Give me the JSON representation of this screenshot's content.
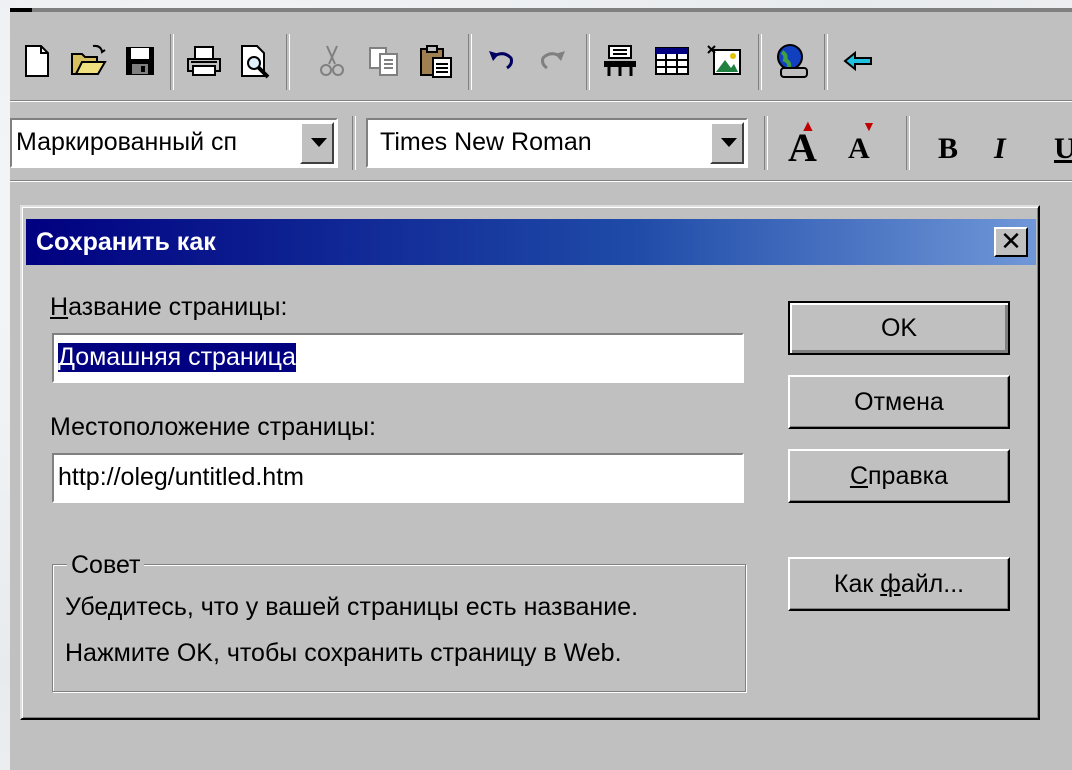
{
  "toolbar": {
    "icons": [
      "new-file-icon",
      "open-folder-icon",
      "save-icon",
      "print-icon",
      "print-preview-icon",
      "cut-icon",
      "copy-icon",
      "paste-icon",
      "undo-icon",
      "redo-icon",
      "form-icon",
      "table-icon",
      "image-icon",
      "web-icon",
      "back-arrow-icon"
    ]
  },
  "format_bar": {
    "style_value": "Маркированный сп",
    "font_value": "Times New Roman",
    "grow_font": "A",
    "shrink_font": "A",
    "bold": "B",
    "italic": "I"
  },
  "dialog": {
    "title": "Сохранить как",
    "close_glyph": "✕",
    "title_label_prefix": "Н",
    "title_label_rest": "азвание страницы:",
    "title_value": "Домашняя страница",
    "location_label": "Местоположение страницы:",
    "location_value": "http://oleg/untitled.htm",
    "buttons": {
      "ok": "OK",
      "cancel": "Отмена",
      "help_prefix": "С",
      "help_rest": "правка",
      "as_file_prefix": "Как ",
      "as_file_u": "ф",
      "as_file_rest": "айл..."
    },
    "tip": {
      "label": "Совет",
      "line1": "Убедитесь, что у вашей страницы есть название.",
      "line2": "Нажмите OK, чтобы сохранить страницу в Web."
    }
  }
}
